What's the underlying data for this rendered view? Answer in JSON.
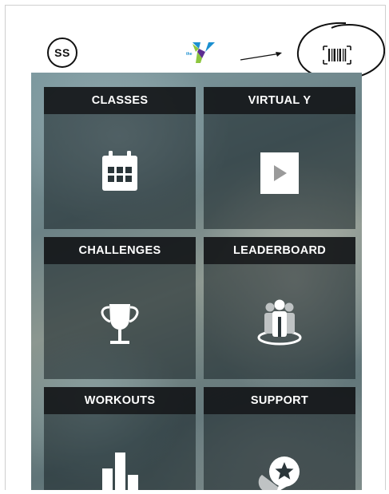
{
  "header": {
    "avatar_initials": "SS",
    "logo_text": "the",
    "barcode_icon": "barcode-icon"
  },
  "colors": {
    "header_bg": "#ffffff",
    "tile_head_bg": "#141618",
    "ymca_blue": "#1b8fd0",
    "ymca_green": "#8dc63f",
    "ymca_purple": "#5c2d91"
  },
  "tiles": [
    {
      "label": "CLASSES",
      "icon": "calendar-icon"
    },
    {
      "label": "VIRTUAL Y",
      "icon": "play-icon"
    },
    {
      "label": "CHALLENGES",
      "icon": "trophy-icon"
    },
    {
      "label": "LEADERBOARD",
      "icon": "group-icon"
    },
    {
      "label": "WORKOUTS",
      "icon": "bar-chart-icon"
    },
    {
      "label": "SUPPORT",
      "icon": "chat-star-icon"
    }
  ]
}
